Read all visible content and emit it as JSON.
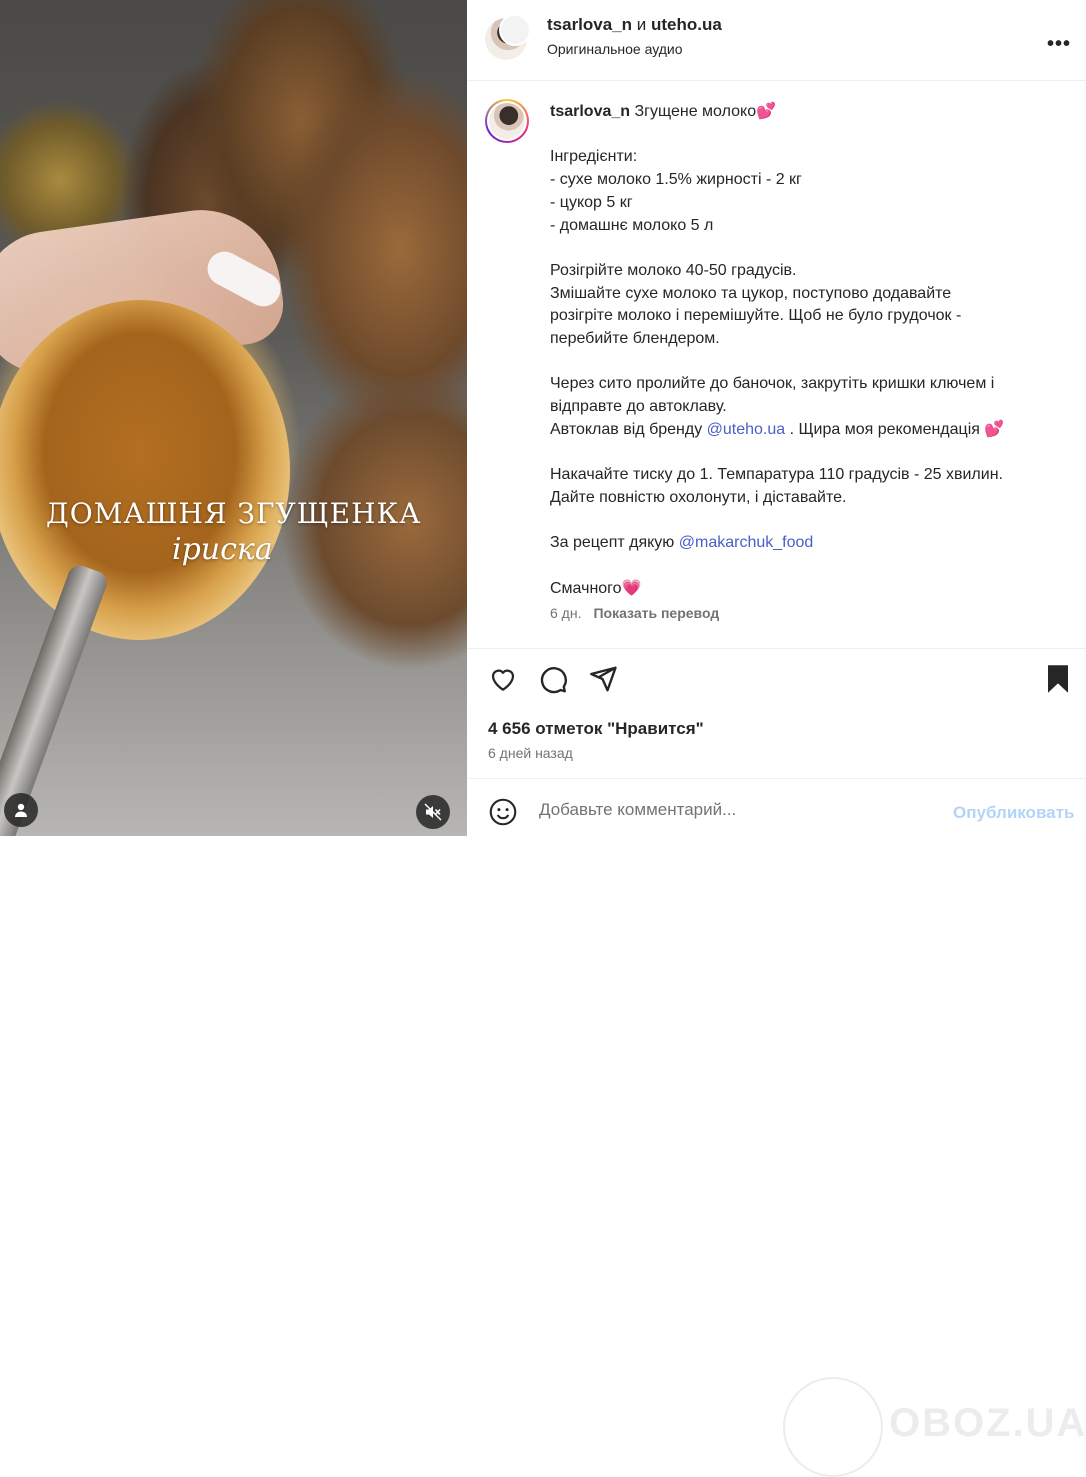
{
  "media": {
    "caption_line1": "ДОМАШНЯ ЗГУЩЕНКА",
    "caption_line2": "іриска"
  },
  "header": {
    "user1": "tsarlova_n",
    "conj": " и ",
    "user2": "uteho.ua",
    "audio": "Оригинальное аудио",
    "more_label": "•••"
  },
  "post": {
    "author": "tsarlova_n",
    "title_text": " Згущене молоко",
    "title_emoji": "💕",
    "lines": [
      "Інгредієнти:",
      "- сухе молоко 1.5% жирності - 2 кг",
      "- цукор 5 кг",
      "- домашнє молоко 5 л",
      "",
      "Розігрійте молоко 40-50 градусів.",
      "Змішайте сухе молоко та цукор, поступово додавайте",
      "розігріте молоко і перемішуйте. Щоб не було грудочок -",
      "перебийте блендером.",
      "",
      "Через сито пролийте до баночок, закрутіть кришки ключем і",
      "відправте до автоклаву."
    ],
    "autoclave_prefix": "Автоклав від бренду ",
    "autoclave_link": "@uteho.ua",
    "autoclave_suffix": " . Щира моя рекомендація ",
    "autoclave_emoji": "💕",
    "lines2": [
      "Накачайте тиску до 1. Темпаратура 110 градусів - 25 хвилин.",
      "Дайте повністю охолонути, і діставайте."
    ],
    "thanks_prefix": "За рецепт дякую ",
    "thanks_link": "@makarchuk_food",
    "closing": "Смачного",
    "closing_emoji": "💗",
    "age": "6 дн.",
    "translate": "Показать перевод"
  },
  "actions": {
    "likes": "4 656 отметок \"Нравится\"",
    "date": "6 дней назад"
  },
  "comment": {
    "placeholder": "Добавьте комментарий...",
    "publish": "Опубликовать"
  },
  "watermark": "OBOZ.UA"
}
